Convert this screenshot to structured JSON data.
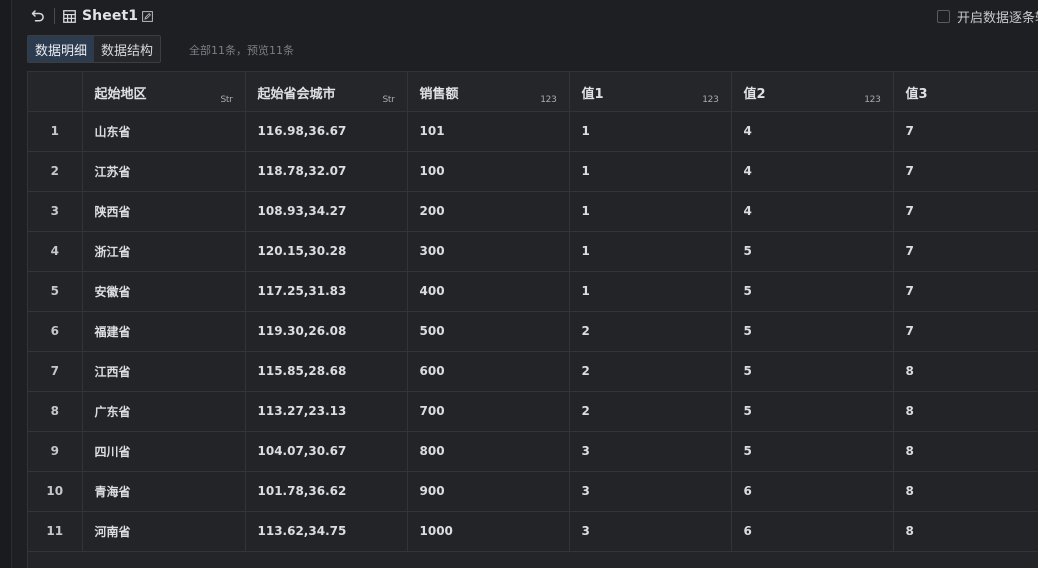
{
  "header": {
    "sheet_name": "Sheet1",
    "auto_label": "开启数据逐条轮"
  },
  "tabs": [
    {
      "label": "数据明细",
      "active": true
    },
    {
      "label": "数据结构",
      "active": false
    }
  ],
  "count_text": "全部11条，预览11条",
  "table": {
    "columns": [
      {
        "name": "起始地区",
        "type": "Str"
      },
      {
        "name": "起始省会城市",
        "type": "Str"
      },
      {
        "name": "销售额",
        "type": "123"
      },
      {
        "name": "值1",
        "type": "123"
      },
      {
        "name": "值2",
        "type": "123"
      },
      {
        "name": "值3",
        "type": "123"
      }
    ],
    "rows": [
      {
        "idx": "1",
        "cells": [
          "山东省",
          "116.98,36.67",
          "101",
          "1",
          "4",
          "7"
        ]
      },
      {
        "idx": "2",
        "cells": [
          "江苏省",
          "118.78,32.07",
          "100",
          "1",
          "4",
          "7"
        ]
      },
      {
        "idx": "3",
        "cells": [
          "陕西省",
          "108.93,34.27",
          "200",
          "1",
          "4",
          "7"
        ]
      },
      {
        "idx": "4",
        "cells": [
          "浙江省",
          "120.15,30.28",
          "300",
          "1",
          "5",
          "7"
        ]
      },
      {
        "idx": "5",
        "cells": [
          "安徽省",
          "117.25,31.83",
          "400",
          "1",
          "5",
          "7"
        ]
      },
      {
        "idx": "6",
        "cells": [
          "福建省",
          "119.30,26.08",
          "500",
          "2",
          "5",
          "7"
        ]
      },
      {
        "idx": "7",
        "cells": [
          "江西省",
          "115.85,28.68",
          "600",
          "2",
          "5",
          "8"
        ]
      },
      {
        "idx": "8",
        "cells": [
          "广东省",
          "113.27,23.13",
          "700",
          "2",
          "5",
          "8"
        ]
      },
      {
        "idx": "9",
        "cells": [
          "四川省",
          "104.07,30.67",
          "800",
          "3",
          "5",
          "8"
        ]
      },
      {
        "idx": "10",
        "cells": [
          "青海省",
          "101.78,36.62",
          "900",
          "3",
          "6",
          "8"
        ]
      },
      {
        "idx": "11",
        "cells": [
          "河南省",
          "113.62,34.75",
          "1000",
          "3",
          "6",
          "8"
        ]
      }
    ]
  },
  "icons": {
    "back": "undo-arrow-icon",
    "sheet": "table-grid-icon",
    "edit": "edit-pencil-icon"
  },
  "colors": {
    "background": "#1e1f22",
    "active_tab": "#2d3b4e",
    "grid_line": "#333438"
  }
}
